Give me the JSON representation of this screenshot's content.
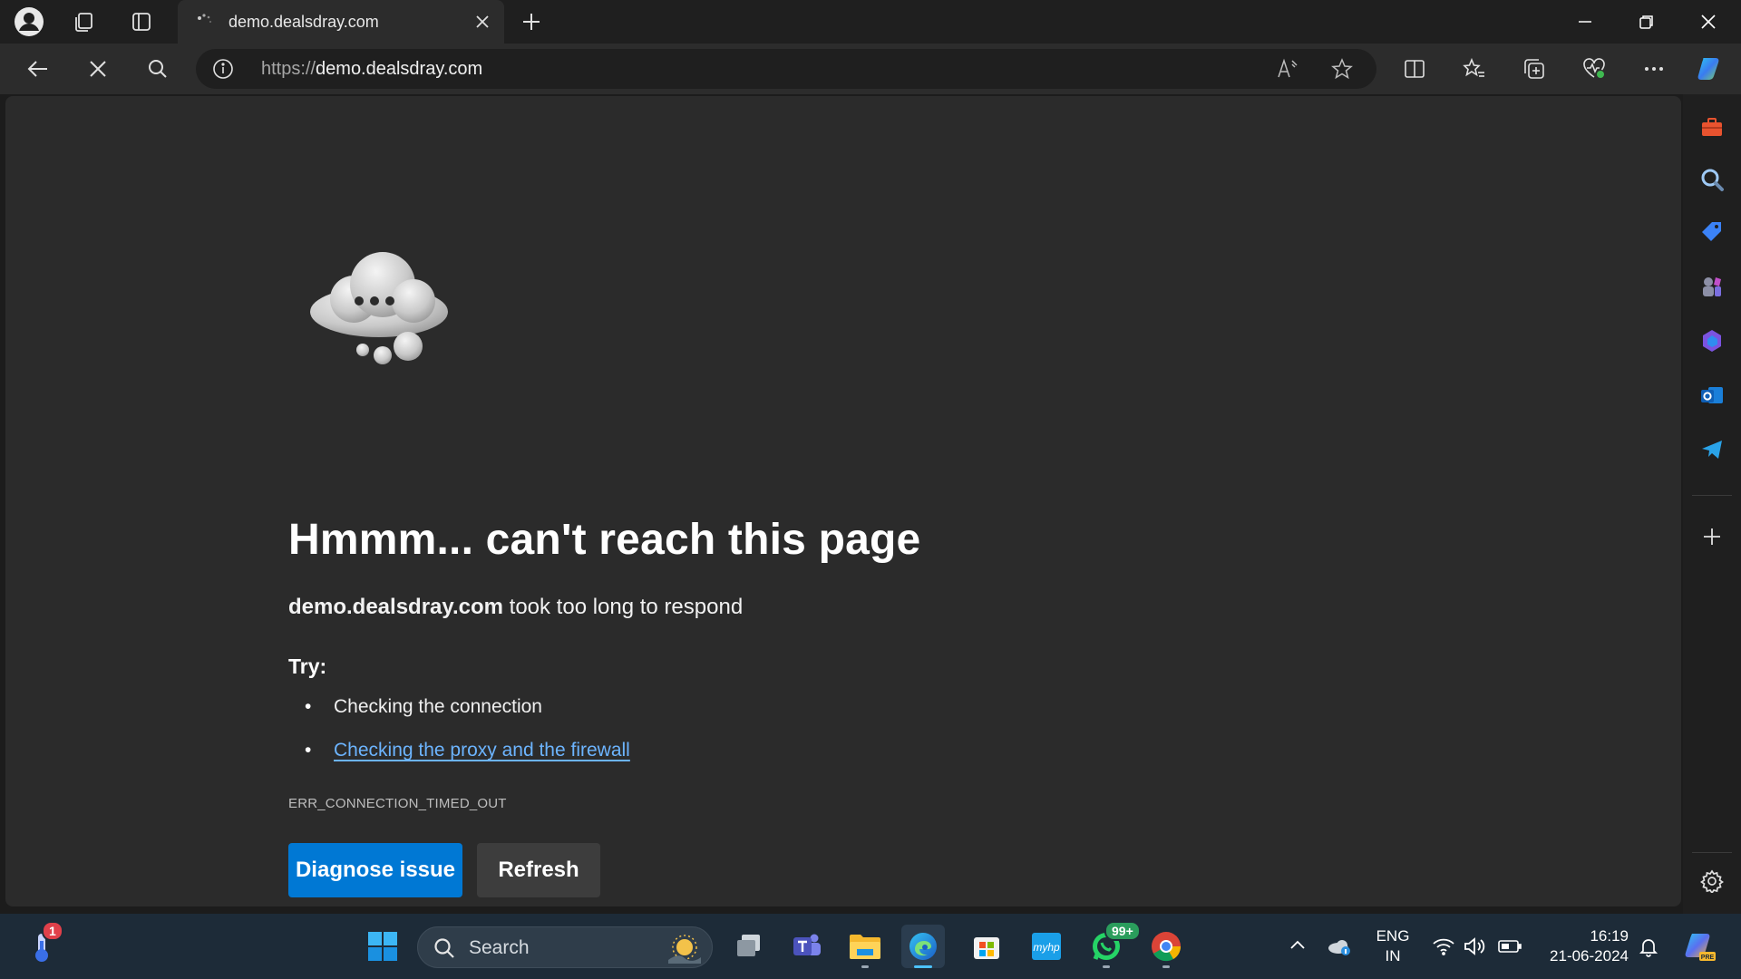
{
  "browser": {
    "tab": {
      "title": "demo.dealsdray.com"
    },
    "address_bar": {
      "scheme": "https://",
      "host": "demo.dealsdray.com"
    }
  },
  "page": {
    "title": "Hmmm... can't reach this page",
    "description_host": "demo.dealsdray.com",
    "description_rest": " took too long to respond",
    "try_label": "Try:",
    "suggestions": [
      {
        "text": "Checking the connection",
        "is_link": false
      },
      {
        "text": "Checking the proxy and the firewall",
        "is_link": true
      }
    ],
    "error_code": "ERR_CONNECTION_TIMED_OUT",
    "buttons": {
      "diagnose": "Diagnose issue",
      "refresh": "Refresh"
    }
  },
  "taskbar": {
    "weather_badge": "1",
    "search_label": "Search",
    "whatsapp_badge": "99+",
    "language": {
      "lang": "ENG",
      "region": "IN"
    },
    "clock": {
      "time": "16:19",
      "date": "21-06-2024"
    }
  },
  "icons": {
    "titlebar": [
      "profile-icon",
      "workspaces-icon",
      "tab-actions-icon"
    ],
    "toolbar": [
      "back-icon",
      "stop-loading-icon",
      "search-icon",
      "split-screen-icon",
      "favorites-icon",
      "collections-icon",
      "browser-essentials-icon",
      "more-icon",
      "copilot-icon"
    ],
    "sidebar": [
      "tools-icon",
      "search-icon",
      "shopping-icon",
      "games-icon",
      "microsoft365-icon",
      "outlook-icon",
      "telegram-icon",
      "add-icon",
      "settings-icon"
    ]
  },
  "colors": {
    "accent": "#0078d4",
    "link": "#6cb4ff",
    "page_bg": "#2b2b2b",
    "taskbar_bg": "#1d2b38"
  }
}
